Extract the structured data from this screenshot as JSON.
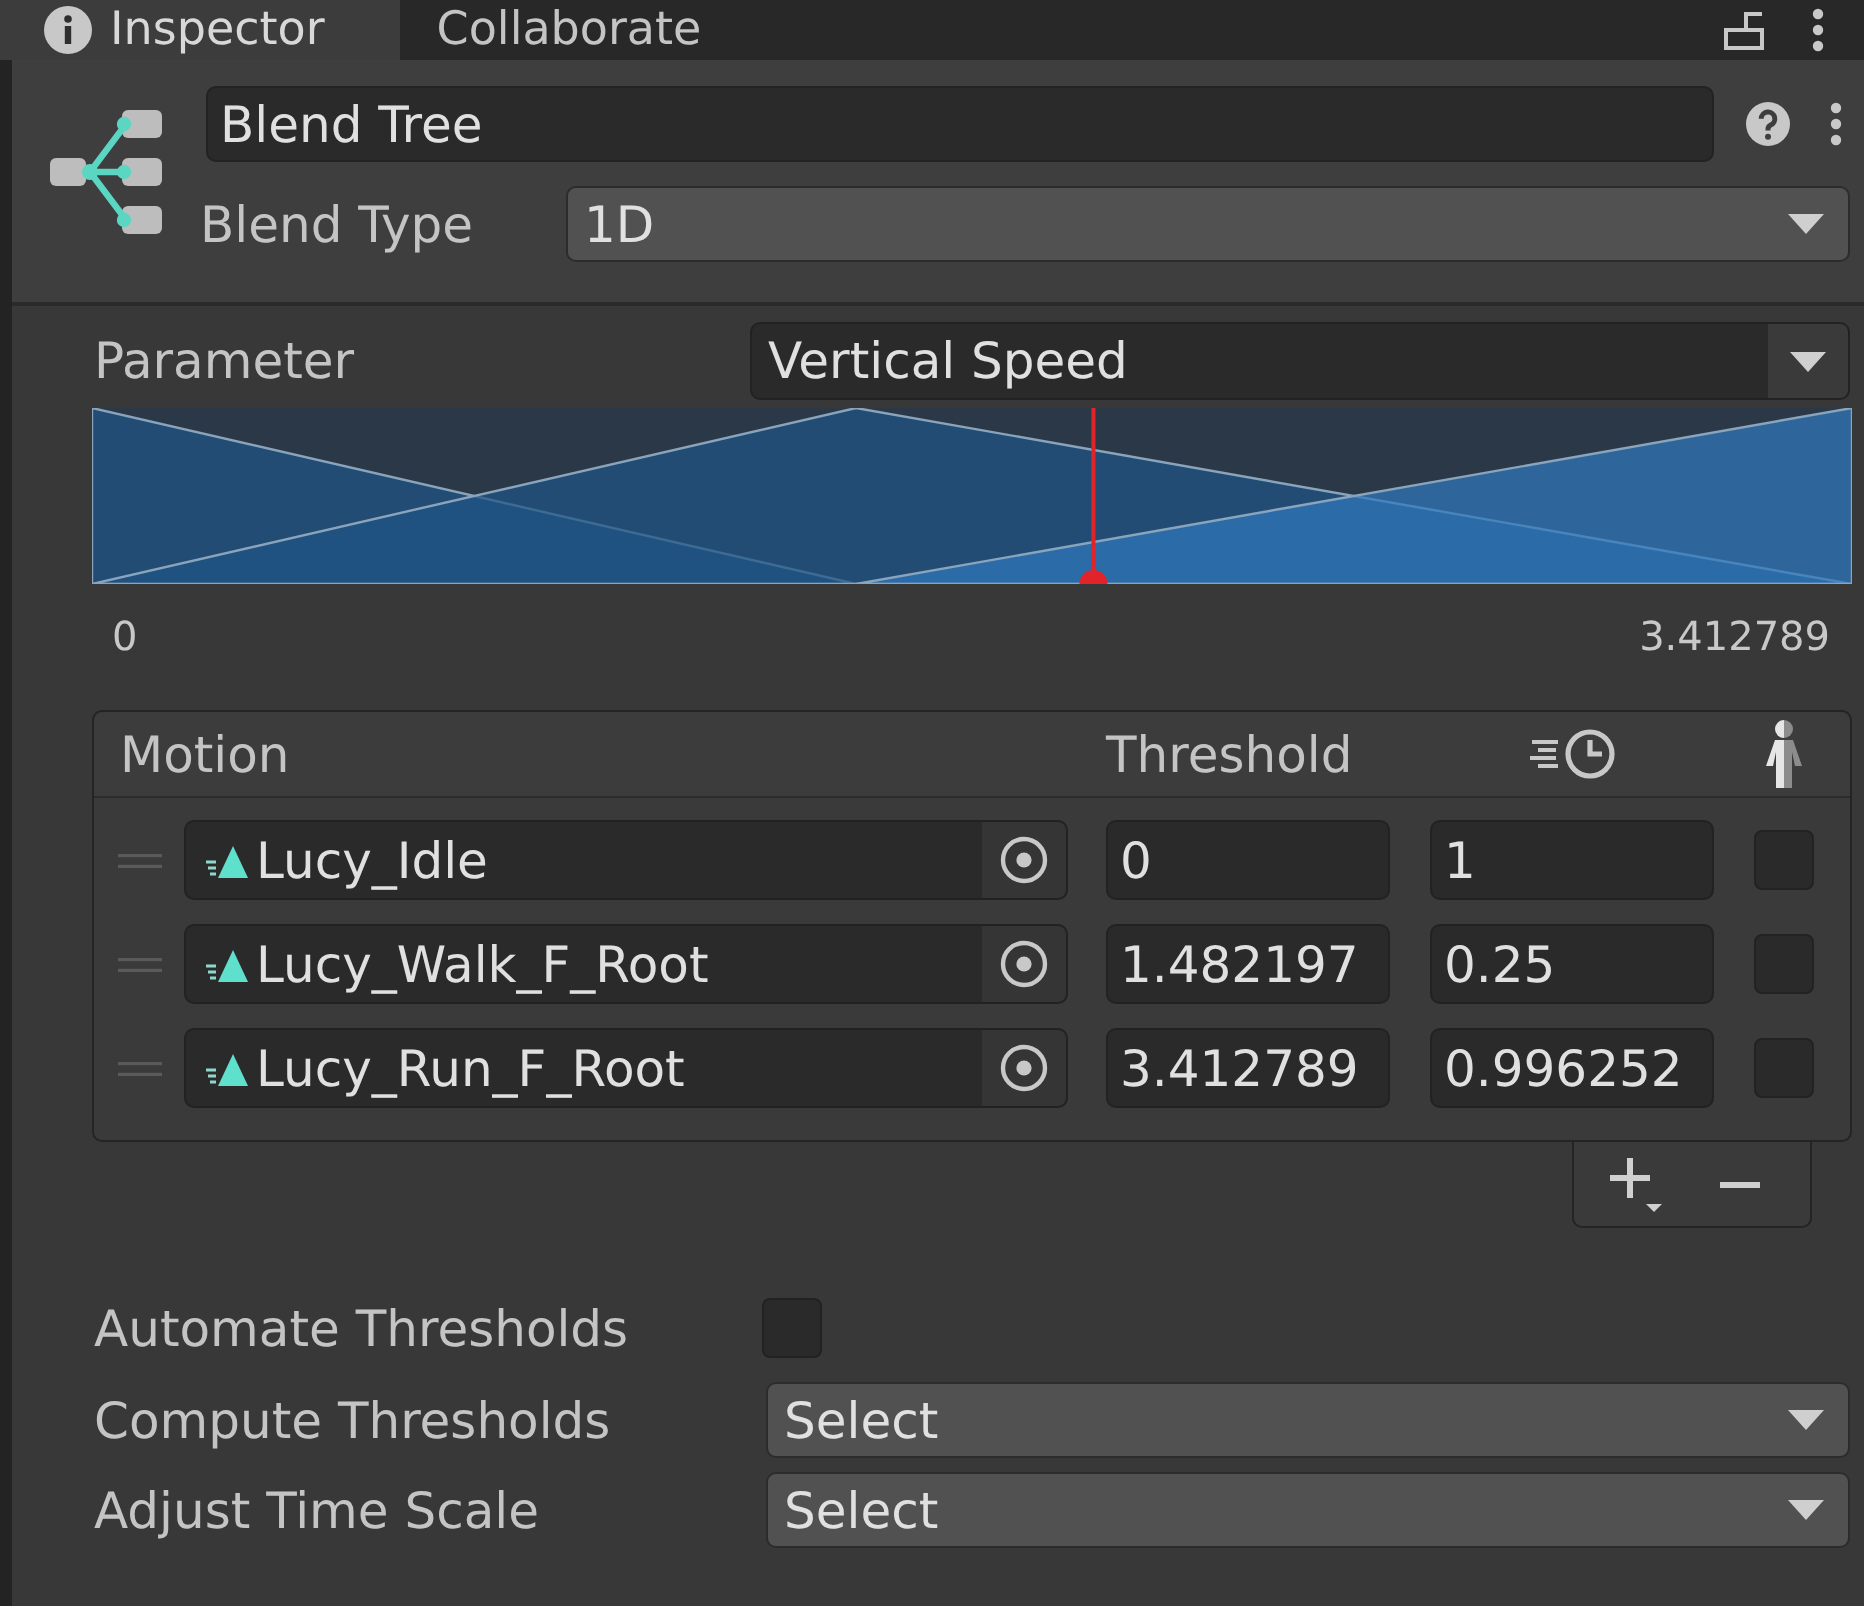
{
  "tabs": [
    {
      "label": "Inspector",
      "selected": true
    },
    {
      "label": "Collaborate",
      "selected": false
    }
  ],
  "header": {
    "name": "Blend Tree",
    "blend_type": {
      "label": "Blend Type",
      "value": "1D"
    }
  },
  "parameter": {
    "label": "Parameter",
    "value": "Vertical Speed"
  },
  "blend_graph": {
    "marker": {
      "level": 0.569
    },
    "range_labels": [
      "0",
      "3.412789"
    ]
  },
  "motion_table": {
    "columns": [
      {
        "kind": "text",
        "label": "Motion"
      },
      {
        "kind": "text",
        "label": "Threshold"
      },
      {
        "kind": "time_scale"
      },
      {
        "kind": "mirror"
      }
    ],
    "rows": [
      {
        "motion": "Lucy_Idle",
        "threshold": "0",
        "time_scale": "1",
        "mirror": false
      },
      {
        "motion": "Lucy_Walk_F_Root",
        "threshold": "1.482197",
        "time_scale": "0.25",
        "mirror": false
      },
      {
        "motion": "Lucy_Run_F_Root",
        "threshold": "3.412789",
        "time_scale": "0.996252",
        "mirror": false
      }
    ]
  },
  "settings": [
    {
      "kind": "checkbox",
      "label": "Automate Thresholds",
      "checked": false
    },
    {
      "kind": "dropdown",
      "label": "Compute Thresholds",
      "value": "Select"
    },
    {
      "kind": "dropdown",
      "label": "Adjust Time Scale",
      "value": "Select"
    }
  ]
}
